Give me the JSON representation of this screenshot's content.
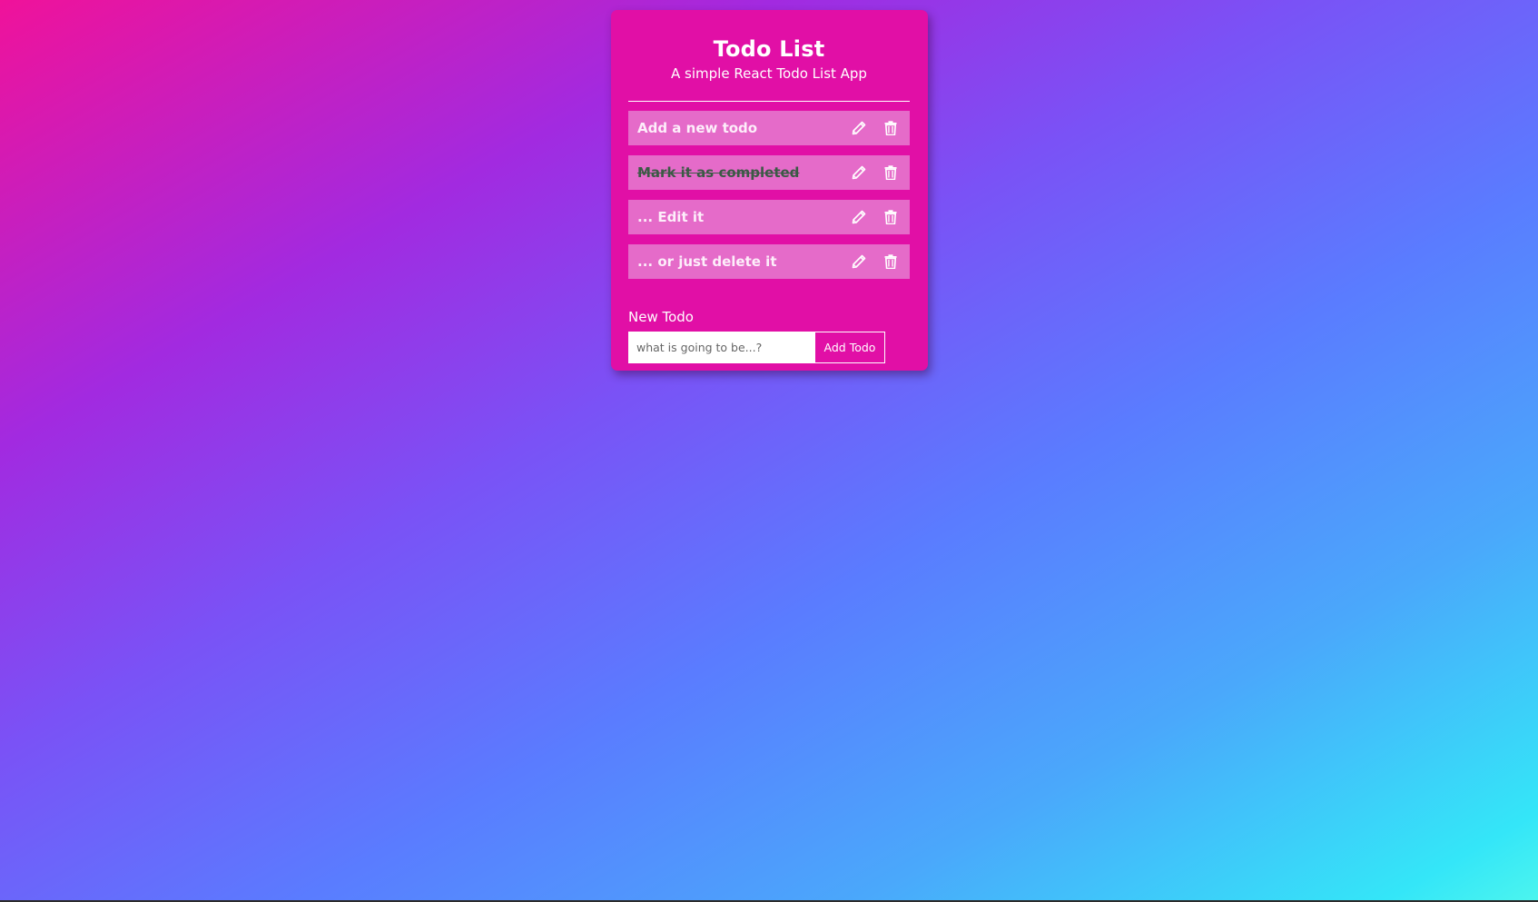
{
  "app": {
    "title": "Todo List",
    "subtitle": "A simple React Todo List App"
  },
  "todos": [
    {
      "text": "Add a new todo",
      "completed": false
    },
    {
      "text": "Mark it as completed",
      "completed": true
    },
    {
      "text": "... Edit it",
      "completed": false
    },
    {
      "text": "... or just delete it",
      "completed": false
    }
  ],
  "icons": {
    "edit": "pencil-icon",
    "delete": "trash-icon"
  },
  "form": {
    "label": "New Todo",
    "placeholder": "what is going to be...?",
    "value": "",
    "button_label": "Add Todo"
  },
  "colors": {
    "card_background": "#e10fa6",
    "item_background": "#e56bc9",
    "completed_text": "#3b5a45",
    "gradient_start": "#f0129a",
    "gradient_end": "#4cf5ee"
  }
}
